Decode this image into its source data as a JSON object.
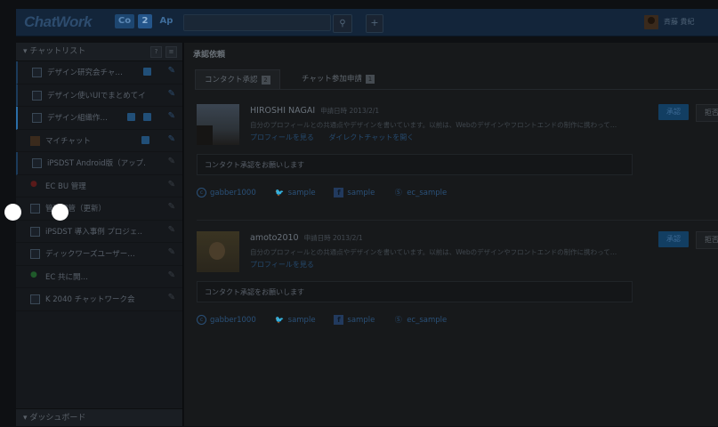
{
  "header": {
    "logo": "ChatWork",
    "icon_labels": [
      "Co",
      "2",
      "Ap"
    ],
    "search_placeholder": "",
    "search_icon": "search-icon",
    "plus_icon": "+",
    "user_name": "斉藤 貴紀"
  },
  "sidebar": {
    "chat_list_title": "▾ チャットリスト",
    "tools": [
      "?",
      "≡"
    ],
    "rooms": [
      {
        "name": "デザイン研究会チャ…",
        "icon": "room",
        "pin": true
      },
      {
        "name": "デザイン使いUIでまとめてイー…",
        "icon": "room",
        "pin": true
      },
      {
        "name": "デザイン組織作…",
        "icon": "room",
        "pin": true
      },
      {
        "name": "マイチャット",
        "icon": "photo",
        "pin": true
      },
      {
        "name": "iPSDST Android版（アップ…",
        "icon": "room",
        "pin": false
      },
      {
        "name": "EC BU 管理",
        "icon": "red",
        "pin": false
      },
      {
        "name": "管理保管（更新）",
        "icon": "room",
        "pin": false
      },
      {
        "name": "iPSDST 導入事例 プロジェ…",
        "icon": "room",
        "pin": false
      },
      {
        "name": "ディックワーズユーザー…",
        "icon": "room",
        "pin": false
      },
      {
        "name": "EC 共に開…",
        "icon": "green",
        "pin": false
      },
      {
        "name": "K 2040 チャットワーク会",
        "icon": "room",
        "pin": false
      }
    ],
    "dashboard_title": "▾ ダッシュボード"
  },
  "main": {
    "title": "承認依頼",
    "tabs": [
      {
        "label": "コンタクト承認",
        "count": "2"
      },
      {
        "label": "チャット参加申請",
        "count": "1"
      }
    ],
    "requests": [
      {
        "name": "HIROSHI NAGAI",
        "date": "申請日時 2013/2/1",
        "description": "自分のプロフィールとの共通点やデザインを書いています。以前は、Webのデザインやフロントエンドの制作に携わって…",
        "links": [
          "プロフィールを見る",
          "ダイレクトチャットを開く"
        ],
        "message": "コンタクト承認をお願いします",
        "accounts": [
          {
            "icon": "chatwork-icon",
            "label": "gabber1000"
          },
          {
            "icon": "twitter-icon",
            "label": "sample"
          },
          {
            "icon": "facebook-icon",
            "label": "sample"
          },
          {
            "icon": "skype-icon",
            "label": "ec_sample"
          }
        ],
        "accept": "承認",
        "reject": "拒否"
      },
      {
        "name": "amoto2010",
        "date": "申請日時 2013/2/1",
        "description": "自分のプロフィールとの共通点やデザインを書いています。以前は、Webのデザインやフロントエンドの制作に携わって…",
        "links": [
          "プロフィールを見る"
        ],
        "message": "コンタクト承認をお願いします",
        "accounts": [
          {
            "icon": "chatwork-icon",
            "label": "gabber1000"
          },
          {
            "icon": "twitter-icon",
            "label": "sample"
          },
          {
            "icon": "facebook-icon",
            "label": "sample"
          },
          {
            "icon": "skype-icon",
            "label": "ec_sample"
          }
        ],
        "accept": "承認",
        "reject": "拒否"
      }
    ]
  }
}
